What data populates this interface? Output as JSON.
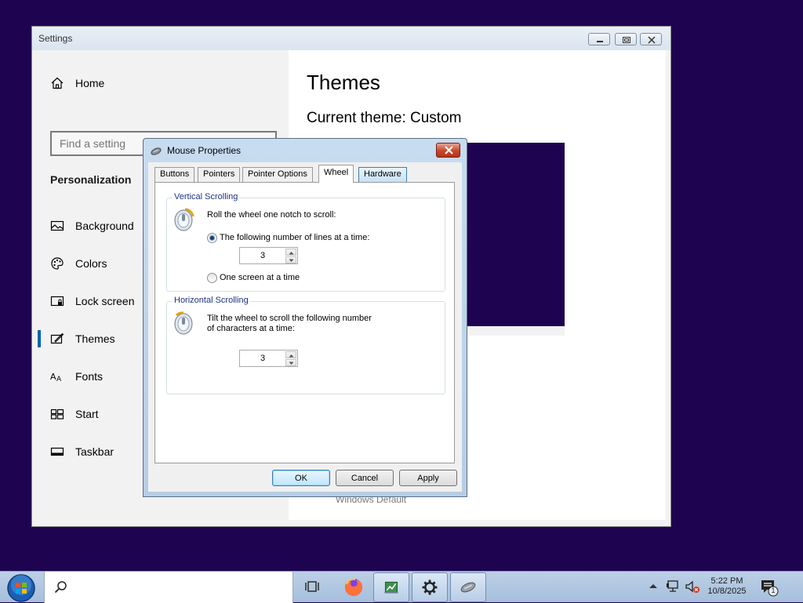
{
  "settings_window": {
    "title": "Settings",
    "sidebar": {
      "home": "Home",
      "search_placeholder": "Find a setting",
      "section": "Personalization",
      "items": [
        {
          "label": "Background",
          "icon": "picture-icon"
        },
        {
          "label": "Colors",
          "icon": "palette-icon"
        },
        {
          "label": "Lock screen",
          "icon": "lock-screen-icon"
        },
        {
          "label": "Themes",
          "icon": "themes-icon",
          "active": true
        },
        {
          "label": "Fonts",
          "icon": "fonts-icon"
        },
        {
          "label": "Start",
          "icon": "start-icon"
        },
        {
          "label": "Taskbar",
          "icon": "taskbar-icon"
        }
      ]
    },
    "main": {
      "title": "Themes",
      "current_theme": "Current theme: Custom",
      "partial_list_item": "Windows Default",
      "preview_color": "#1e0450"
    }
  },
  "dialog": {
    "title": "Mouse Properties",
    "tabs": [
      "Buttons",
      "Pointers",
      "Pointer Options",
      "Wheel",
      "Hardware"
    ],
    "selected_tab": "Wheel",
    "vertical": {
      "label": "Vertical Scrolling",
      "text": "Roll the wheel one notch to scroll:",
      "option_lines": "The following number of lines at a time:",
      "lines_value": "3",
      "option_screen": "One screen at a time",
      "selected_option": "lines"
    },
    "horizontal": {
      "label": "Horizontal Scrolling",
      "text_line1": "Tilt the wheel to scroll the following number",
      "text_line2": "of characters at a time:",
      "chars_value": "3"
    },
    "buttons": {
      "ok": "OK",
      "cancel": "Cancel",
      "apply": "Apply"
    }
  },
  "taskbar": {
    "time": "5:22 PM",
    "date": "10/8/2025",
    "notification_count": "1",
    "colors": {
      "desktop": "#1e0450",
      "accent": "#0063b1"
    }
  }
}
